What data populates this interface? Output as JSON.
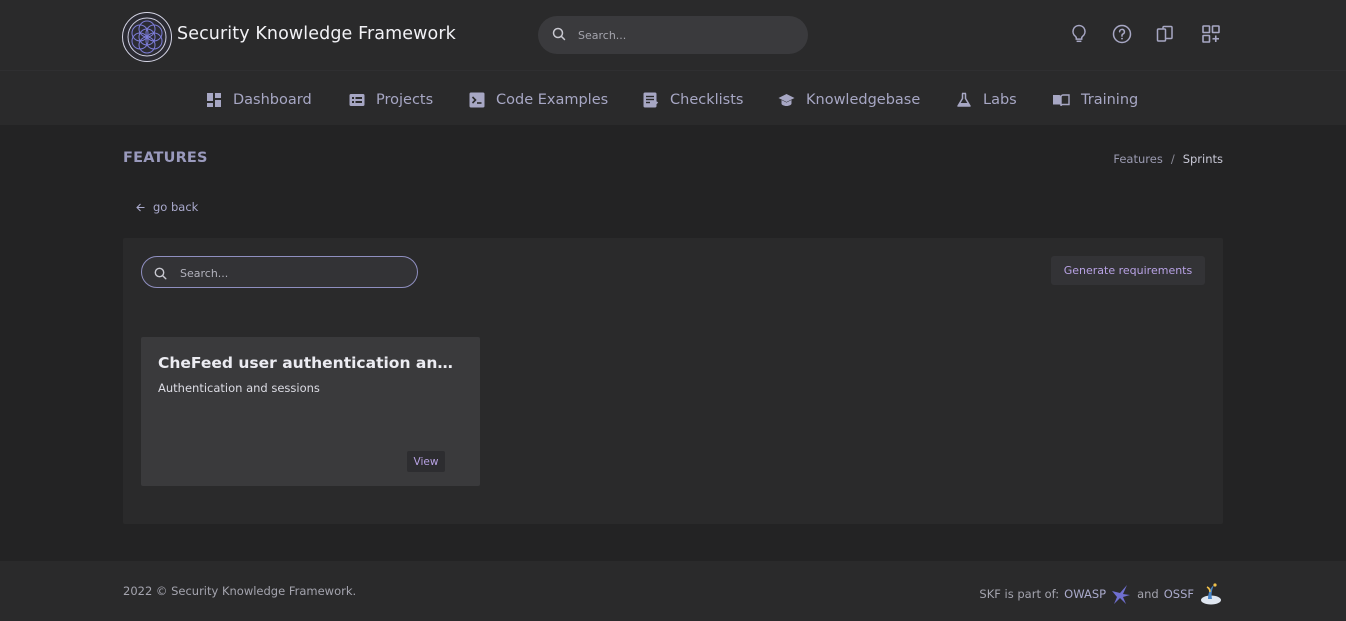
{
  "header": {
    "brand": "Security Knowledge Framework",
    "search_placeholder": "Search...",
    "icons": [
      "lightbulb-icon",
      "help-circle-icon",
      "book-icon",
      "apps-add-icon"
    ]
  },
  "nav": {
    "items": [
      {
        "label": "Dashboard",
        "icon": "dashboard-icon"
      },
      {
        "label": "Projects",
        "icon": "projects-icon"
      },
      {
        "label": "Code Examples",
        "icon": "terminal-icon"
      },
      {
        "label": "Checklists",
        "icon": "checklist-icon"
      },
      {
        "label": "Knowledgebase",
        "icon": "school-icon"
      },
      {
        "label": "Labs",
        "icon": "flask-icon"
      },
      {
        "label": "Training",
        "icon": "book-open-icon"
      }
    ]
  },
  "page": {
    "title": "FEATURES",
    "breadcrumb": {
      "items": [
        "Features",
        "Sprints"
      ],
      "separator": "/"
    },
    "go_back": "go back"
  },
  "panel": {
    "search_placeholder": "Search...",
    "generate_button": "Generate requirements",
    "cards": [
      {
        "title": "CheFeed user authentication and sessions",
        "subtitle": "Authentication and sessions",
        "button": "View"
      }
    ]
  },
  "footer": {
    "copyright": "2022 © Security Knowledge Framework.",
    "partner_prefix": "SKF is part of:",
    "owasp": "OWASP",
    "and": "and",
    "ossf": "OSSF"
  },
  "colors": {
    "background": "#232324",
    "bar": "#2a2a2b",
    "accent": "#b8a2e4",
    "nav_text": "#a7a7c4"
  }
}
